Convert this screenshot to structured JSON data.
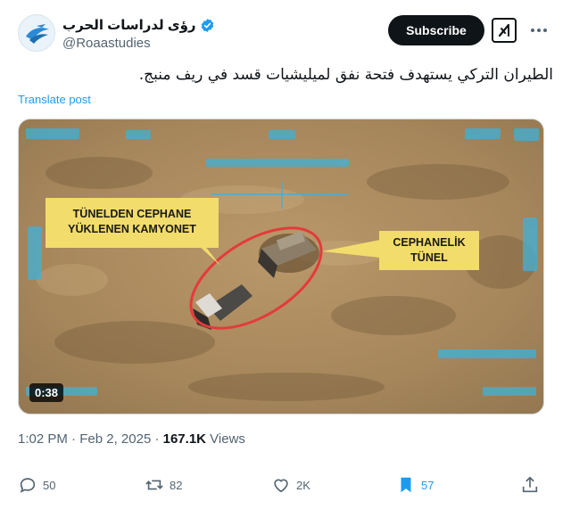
{
  "author": {
    "display_name": "رؤى لدراسات الحرب",
    "handle": "@Roaastudies",
    "verified_icon": "verified-badge-icon"
  },
  "header": {
    "subscribe_label": "Subscribe",
    "grok_icon": "grok-icon",
    "more_icon": "more-options-icon"
  },
  "post": {
    "text": "الطيران التركي يستهدف فتحة نفق لميليشيات قسد في ريف منبج.",
    "translate_label": "Translate post"
  },
  "media": {
    "label_left": "TÜNELDEN CEPHANE YÜKLENEN KAMYONET",
    "label_left_line1": "TÜNELDEN CEPHANE",
    "label_left_line2": "YÜKLENEN KAMYONET",
    "label_right_line1": "CEPHANELİK",
    "label_right_line2": "TÜNEL",
    "duration": "0:38",
    "label_color": "#f2dc6b",
    "highlight_color": "#e53a3a"
  },
  "meta": {
    "time": "1:02 PM",
    "separator": "·",
    "date": "Feb 2, 2025",
    "views_count": "167.1K",
    "views_label": "Views"
  },
  "actions": {
    "replies": "50",
    "reposts": "82",
    "likes": "2K",
    "bookmarks": "57"
  },
  "colors": {
    "accent": "#1d9bf0",
    "text": "#0f1419",
    "muted": "#536471"
  }
}
